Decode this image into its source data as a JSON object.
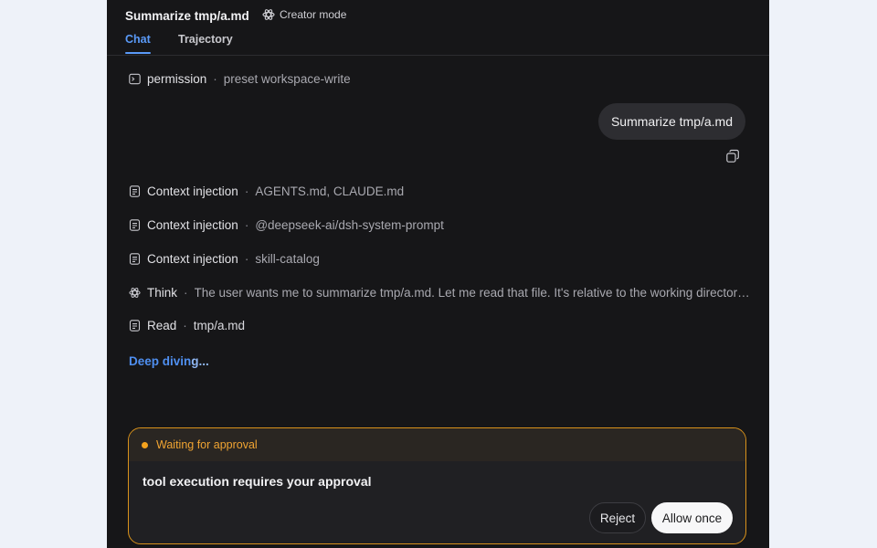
{
  "header": {
    "title": "Summarize tmp/a.md",
    "creator_mode": "Creator mode",
    "tabs": [
      {
        "label": "Chat",
        "active": true
      },
      {
        "label": "Trajectory",
        "active": false
      }
    ]
  },
  "events": {
    "permission": {
      "label": "permission",
      "detail": "preset workspace-write",
      "icon": "terminal-icon"
    },
    "context": [
      {
        "label": "Context injection",
        "detail": "AGENTS.md, CLAUDE.md",
        "icon": "document-icon"
      },
      {
        "label": "Context injection",
        "detail": "@deepseek-ai/dsh-system-prompt",
        "icon": "document-icon"
      },
      {
        "label": "Context injection",
        "detail": "skill-catalog",
        "icon": "document-icon"
      }
    ],
    "think": {
      "label": "Think",
      "detail": "The user wants me to summarize tmp/a.md. Let me read that file. It's relative to the working directory pre...",
      "icon": "atom-icon"
    },
    "read": {
      "label": "Read",
      "detail": "tmp/a.md",
      "icon": "document-icon"
    }
  },
  "user_message": "Summarize tmp/a.md",
  "status": {
    "deep_diving_a": "Deep divin",
    "deep_diving_b": "g..."
  },
  "approval": {
    "status": "Waiting for approval",
    "message": "tool execution requires your approval",
    "reject_label": "Reject",
    "allow_label": "Allow once"
  },
  "colors": {
    "panel_bg": "#161618",
    "page_bg": "#eef2f9",
    "accent_blue": "#5a9af8",
    "approval_border": "#d9921b",
    "approval_dot": "#f3a21d"
  },
  "sep": "·"
}
